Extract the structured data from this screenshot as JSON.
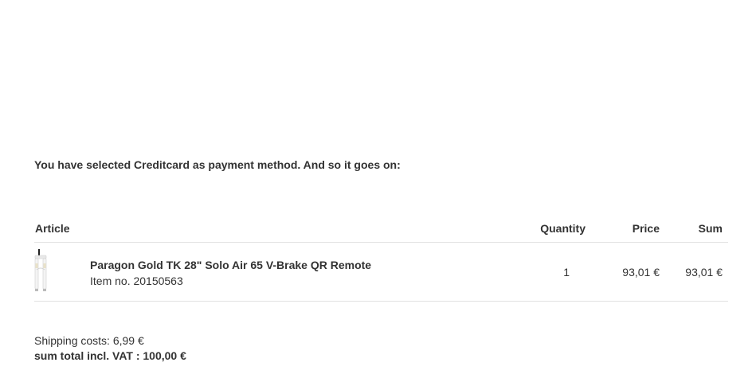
{
  "payment_message": "You have selected Creditcard as payment method. And so it goes on:",
  "table": {
    "headers": {
      "article": "Article",
      "quantity": "Quantity",
      "price": "Price",
      "sum": "Sum"
    },
    "items": [
      {
        "thumbnail_icon": "bike-fork-icon",
        "name": "Paragon Gold TK 28\" Solo Air 65 V-Brake QR Remote",
        "item_no": "Item no. 20150563",
        "quantity": "1",
        "price": "93,01 €",
        "sum": "93,01 €"
      }
    ]
  },
  "totals": {
    "shipping": "Shipping costs: 6,99 €",
    "grand_total": "sum total incl. VAT : 100,00 €"
  }
}
